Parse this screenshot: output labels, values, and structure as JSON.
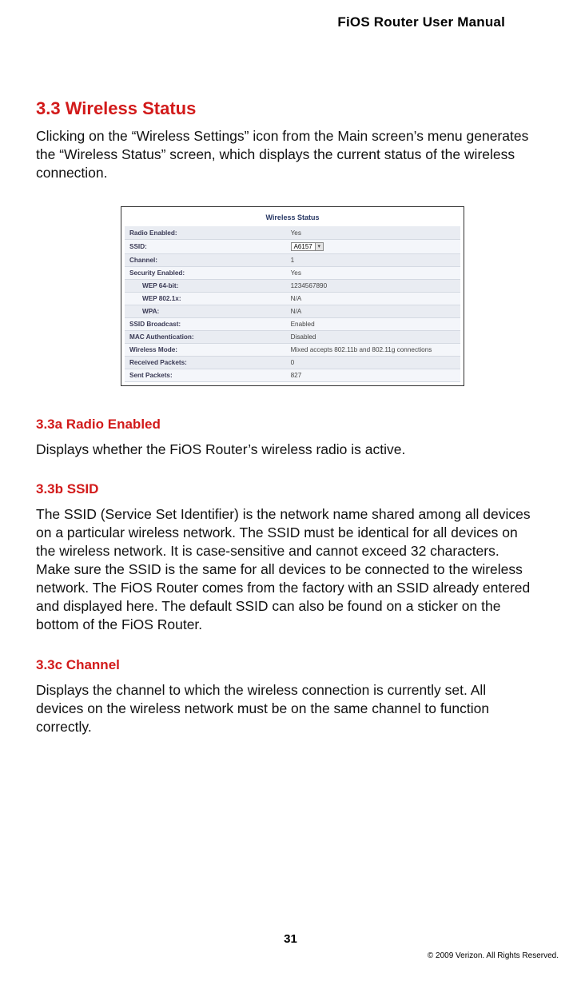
{
  "header": {
    "title": "FiOS Router User Manual"
  },
  "section": {
    "h2": "3.3  Wireless Status",
    "intro": "Clicking on the “Wireless Settings” icon from the Main screen’s menu generates the “Wireless Status” screen, which displays the current status of the wireless connection."
  },
  "figure": {
    "title": "Wireless Status",
    "ssid_value": "A6157",
    "rows": [
      {
        "label": "Radio Enabled:",
        "value": "Yes",
        "indent": false
      },
      {
        "label": "SSID:",
        "value": "__SSID_SELECT__",
        "indent": false
      },
      {
        "label": "Channel:",
        "value": "1",
        "indent": false
      },
      {
        "label": "Security Enabled:",
        "value": "Yes",
        "indent": false
      },
      {
        "label": "WEP 64-bit:",
        "value": "1234567890",
        "indent": true
      },
      {
        "label": "WEP 802.1x:",
        "value": "N/A",
        "indent": true
      },
      {
        "label": "WPA:",
        "value": "N/A",
        "indent": true
      },
      {
        "label": "SSID Broadcast:",
        "value": "Enabled",
        "indent": false
      },
      {
        "label": "MAC Authentication:",
        "value": "Disabled",
        "indent": false
      },
      {
        "label": "Wireless Mode:",
        "value": "Mixed accepts 802.11b and 802.11g connections",
        "indent": false
      },
      {
        "label": "Received Packets:",
        "value": "0",
        "indent": false
      },
      {
        "label": "Sent Packets:",
        "value": "827",
        "indent": false
      }
    ]
  },
  "sub_a": {
    "heading": "3.3a  Radio Enabled",
    "text": "Displays whether the FiOS Router’s wireless radio is active."
  },
  "sub_b": {
    "heading": "3.3b  SSID",
    "text": "The SSID (Service Set Identifier) is the network name shared among all devices on a particular wireless network. The SSID must be identical for all devices on the wireless network. It is case-sensitive and cannot exceed 32 characters. Make sure the SSID is the same for all devices to be connected to the wireless network. The FiOS Router comes from the factory with an SSID already entered and displayed here. The default SSID can also be found on a sticker on the bottom of the FiOS Router."
  },
  "sub_c": {
    "heading": "3.3c  Channel",
    "text": "Displays the channel to which the wireless connection is currently set. All devices on the wireless network must be on the same channel to function correctly."
  },
  "footer": {
    "page": "31",
    "copyright": "© 2009 Verizon. All Rights Reserved."
  }
}
